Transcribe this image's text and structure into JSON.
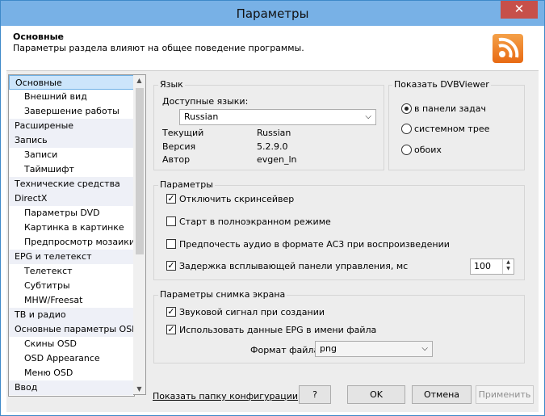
{
  "window": {
    "title": "Параметры",
    "close_glyph": "✕"
  },
  "header": {
    "title": "Основные",
    "subtitle": "Параметры раздела влияют на общее поведение программы.",
    "icon": "rss-icon"
  },
  "tree": {
    "items": [
      {
        "label": "Основные",
        "level": 1,
        "selected": true
      },
      {
        "label": "Внешний вид",
        "level": 2
      },
      {
        "label": "Завершение работы",
        "level": 2
      },
      {
        "label": "Расширеные",
        "level": 1
      },
      {
        "label": "Запись",
        "level": 1
      },
      {
        "label": "Записи",
        "level": 2
      },
      {
        "label": "Таймшифт",
        "level": 2
      },
      {
        "label": "Технические средства",
        "level": 1
      },
      {
        "label": "DirectX",
        "level": 1
      },
      {
        "label": "Параметры DVD",
        "level": 2
      },
      {
        "label": "Картинка в картинке",
        "level": 2
      },
      {
        "label": "Предпросмотр мозаики",
        "level": 2
      },
      {
        "label": "EPG и телетекст",
        "level": 1
      },
      {
        "label": "Телетекст",
        "level": 2
      },
      {
        "label": "Субтитры",
        "level": 2
      },
      {
        "label": "MHW/Freesat",
        "level": 2
      },
      {
        "label": "ТВ и радио",
        "level": 1
      },
      {
        "label": "Основные параметры OSD",
        "level": 1
      },
      {
        "label": "Скины OSD",
        "level": 2
      },
      {
        "label": "OSD Appearance",
        "level": 2
      },
      {
        "label": "Меню OSD",
        "level": 2
      },
      {
        "label": "Ввод",
        "level": 1
      }
    ]
  },
  "language": {
    "group_title": "Язык",
    "available_label": "Доступные языки:",
    "selected": "Russian",
    "current_label": "Текущий",
    "current_value": "Russian",
    "version_label": "Версия",
    "version_value": "5.2.9.0",
    "author_label": "Автор",
    "author_value": "evgen_ln"
  },
  "show_dvbviewer": {
    "group_title": "Показать DVBViewer",
    "options": [
      {
        "label": "в панели задач",
        "checked": true
      },
      {
        "label": "системном трее",
        "checked": false
      },
      {
        "label": "обоих",
        "checked": false
      }
    ]
  },
  "params": {
    "group_title": "Параметры",
    "disable_screensaver": {
      "label": "Отключить скринсейвер",
      "checked": true
    },
    "fullscreen_start": {
      "label": "Старт в полноэкранном режиме",
      "checked": false
    },
    "prefer_ac3": {
      "label": "Предпочесть аудио в формате AC3 при воспроизведении",
      "checked": false
    },
    "popup_delay": {
      "label": "Задержка всплывающей панели управления, мс",
      "checked": true,
      "value": "100"
    }
  },
  "screenshot": {
    "group_title": "Параметры снимка экрана",
    "sound": {
      "label": "Звуковой сигнал при создании",
      "checked": true
    },
    "epg_name": {
      "label": "Использовать данные EPG в имени файла",
      "checked": true
    },
    "format_label": "Формат файла:",
    "format_value": "png"
  },
  "footer": {
    "config_link": "Показать папку конфигурации",
    "help": "?",
    "ok": "OK",
    "cancel": "Отмена",
    "apply": "Применить"
  }
}
